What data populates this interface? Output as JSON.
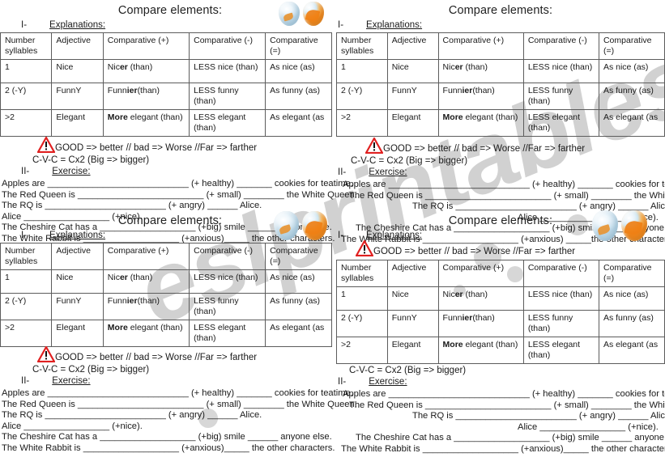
{
  "document": {
    "title": "Compare elements:",
    "watermark": "eslprintables.com"
  },
  "sections": {
    "one_number": "I-",
    "one_label": "Explanations:",
    "two_number": "II-",
    "two_label": "Exercise:"
  },
  "table": {
    "headers": [
      "Number syllables",
      "Adjective",
      "Comparative (+)",
      "Comparative (-)",
      "Comparative (=)"
    ],
    "header_col1_line1": "Number",
    "header_col1_line2": "syllables",
    "rows": [
      {
        "syllables": "1",
        "adjective": "Nice",
        "plus_plain": "Nic",
        "plus_bold": "er",
        "plus_tail": " (than)",
        "minus": "LESS nice (than)",
        "equal": "As nice (as)"
      },
      {
        "syllables": "2 (-Y)",
        "adjective": "FunnY",
        "plus_plain": "Funn",
        "plus_bold": "ier",
        "plus_tail": "(than)",
        "minus": "LESS funny (than)",
        "equal": "As funny (as)"
      },
      {
        "syllables": ">2",
        "adjective": "Elegant",
        "plus_plain": "",
        "plus_bold": "More",
        "plus_tail": " elegant (than)",
        "minus": "LESS elegant (than)",
        "equal": "As elegant (as"
      }
    ]
  },
  "notes": {
    "warning": "GOOD => better  // bad => Worse  //Far => farther",
    "rule": "C-V-C = Cx2 (Big => bigger)",
    "warning_icon": "warning-triangle-icon",
    "warning_color": "#e02020"
  },
  "exercise": {
    "lines": [
      {
        "lead": "Apples are",
        "blank1": "____________________________",
        "cue1": "(+ healthy)",
        "blank2": "_______",
        "tail": "cookies for teatime."
      },
      {
        "lead": "The Red Queen is",
        "blank1": "_________________________",
        "cue1": "(+ small)",
        "blank2": "________",
        "tail": "the White Queen."
      },
      {
        "lead": "The RQ is",
        "blank1": "________________________",
        "cue1": "(+ angry)",
        "blank2": "______",
        "tail": "Alice."
      },
      {
        "lead": "Alice",
        "blank1": "_________________",
        "cue1": "(+nice).",
        "blank2": "",
        "tail": ""
      },
      {
        "lead": "The Cheshire Cat has a",
        "blank1": "___________________",
        "cue1": "(+big) smile",
        "blank2": "______",
        "tail": "anyone else."
      },
      {
        "lead": "The White Rabbit is",
        "blank1": "___________________",
        "cue1": "(+anxious)",
        "blank2": "_____",
        "tail": "the other characters."
      }
    ]
  },
  "images": {
    "fishbowls": "two-fishbowls-image",
    "bowl_left": "fishbowl-clear-with-goldfish",
    "bowl_right": "fishbowl-orange-swirl-with-goldfish"
  }
}
